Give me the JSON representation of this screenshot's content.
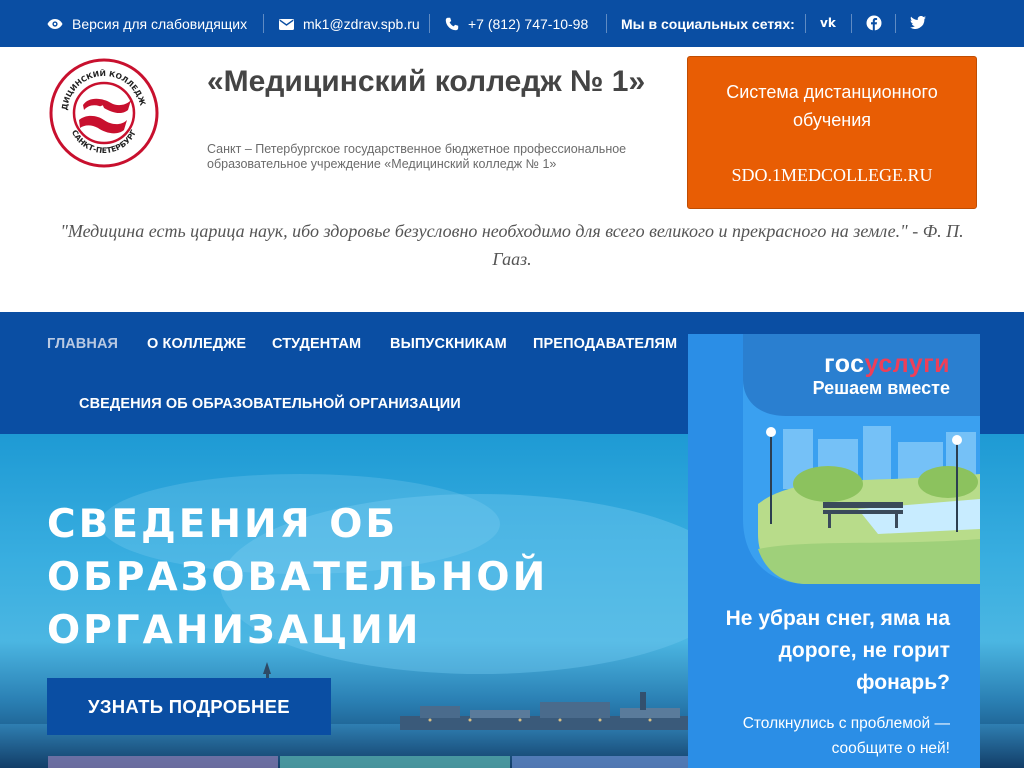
{
  "topbar": {
    "accessibility_label": "Версия для слабовидящих",
    "email": "mk1@zdrav.spb.ru",
    "phone": "+7 (812) 747-10-98",
    "social_label": "Мы в социальных сетях:",
    "socials": [
      "vk-icon",
      "facebook-icon",
      "twitter-icon"
    ]
  },
  "header": {
    "logo_top_text": "МЕДИЦИНСКИЙ КОЛЛЕДЖ №1",
    "logo_bottom_text": "САНКТ-ПЕТЕРБУРГ",
    "title": "«Медицинский колледж № 1»",
    "subtitle": "Санкт – Петербургское государственное бюджетное профессиональное образовательное учреждение «Медицинский колледж № 1»",
    "sdo_line1": "Система дистанционного обучения",
    "sdo_line2": "SDO.1MEDCOLLEGE.RU"
  },
  "quote": "\"Медицина есть царица наук, ибо здоровье безусловно необходимо для всего великого и прекрасного на земле.\" - Ф. П. Гааз.",
  "nav": {
    "items": [
      "ГЛАВНАЯ",
      "О КОЛЛЕДЖЕ",
      "СТУДЕНТАМ",
      "ВЫПУСКНИКАМ",
      "ПРЕПОДАВАТЕЛЯМ",
      "СВЕДЕНИЯ ОБ ОБРАЗОВАТЕЛЬНОЙ ОРГАНИЗАЦИИ"
    ],
    "active": "ГЛАВНАЯ"
  },
  "hero": {
    "title_lines": [
      "СВЕДЕНИЯ ОБ",
      "ОБРАЗОВАТЕЛЬНОЙ",
      "ОРГАНИЗАЦИИ"
    ],
    "button": "УЗНАТЬ ПОДРОБНЕЕ"
  },
  "gosuslugi": {
    "brand_part1": "гос",
    "brand_part2": "услуги",
    "tagline": "Решаем вместе",
    "problem": "Не убран снег, яма на дороге, не горит фонарь?",
    "cta": "Столкнулись с проблемой — сообщите о ней!"
  },
  "colors": {
    "primary": "#0a4ea3",
    "accent": "#e85d04",
    "gos_blue": "#2b8ee6",
    "gos_red": "#ee3f58"
  }
}
